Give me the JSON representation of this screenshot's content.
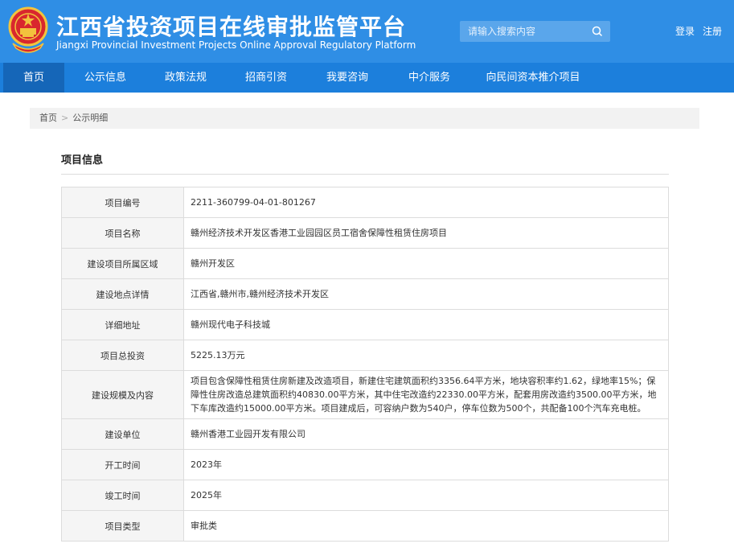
{
  "header": {
    "title_cn": "江西省投资项目在线审批监管平台",
    "title_en": "Jiangxi Provincial Investment Projects Online Approval Regulatory Platform",
    "search_placeholder": "请输入搜索内容",
    "login": "登录",
    "register": "注册"
  },
  "nav": [
    {
      "label": "首页"
    },
    {
      "label": "公示信息"
    },
    {
      "label": "政策法规"
    },
    {
      "label": "招商引资"
    },
    {
      "label": "我要咨询"
    },
    {
      "label": "中介服务"
    },
    {
      "label": "向民间资本推介项目"
    }
  ],
  "breadcrumb": {
    "home": "首页",
    "sep": ">",
    "current": "公示明细"
  },
  "section": {
    "title": "项目信息"
  },
  "rows": [
    {
      "label": "项目编号",
      "value": "2211-360799-04-01-801267"
    },
    {
      "label": "项目名称",
      "value": "赣州经济技术开发区香港工业园园区员工宿舍保障性租赁住房项目"
    },
    {
      "label": "建设项目所属区域",
      "value": "赣州开发区"
    },
    {
      "label": "建设地点详情",
      "value": "江西省,赣州市,赣州经济技术开发区"
    },
    {
      "label": "详细地址",
      "value": "赣州现代电子科技城"
    },
    {
      "label": "项目总投资",
      "value": "5225.13万元"
    },
    {
      "label": "建设规模及内容",
      "value": "项目包含保障性租赁住房新建及改造项目，新建住宅建筑面积约3356.64平方米，地块容积率约1.62，绿地率15%；保障性住房改造总建筑面积约40830.00平方米，其中住宅改造约22330.00平方米，配套用房改造约3500.00平方米，地下车库改造约15000.00平方米。项目建成后，可容纳户数为540户，停车位数为500个，共配备100个汽车充电桩。"
    },
    {
      "label": "建设单位",
      "value": "赣州香港工业园开发有限公司"
    },
    {
      "label": "开工时间",
      "value": "2023年"
    },
    {
      "label": "竣工时间",
      "value": "2025年"
    },
    {
      "label": "项目类型",
      "value": "审批类"
    }
  ],
  "colors": {
    "header": "#2f8ee5",
    "nav": "#1c7fdc",
    "nav_active": "#1566b8"
  }
}
